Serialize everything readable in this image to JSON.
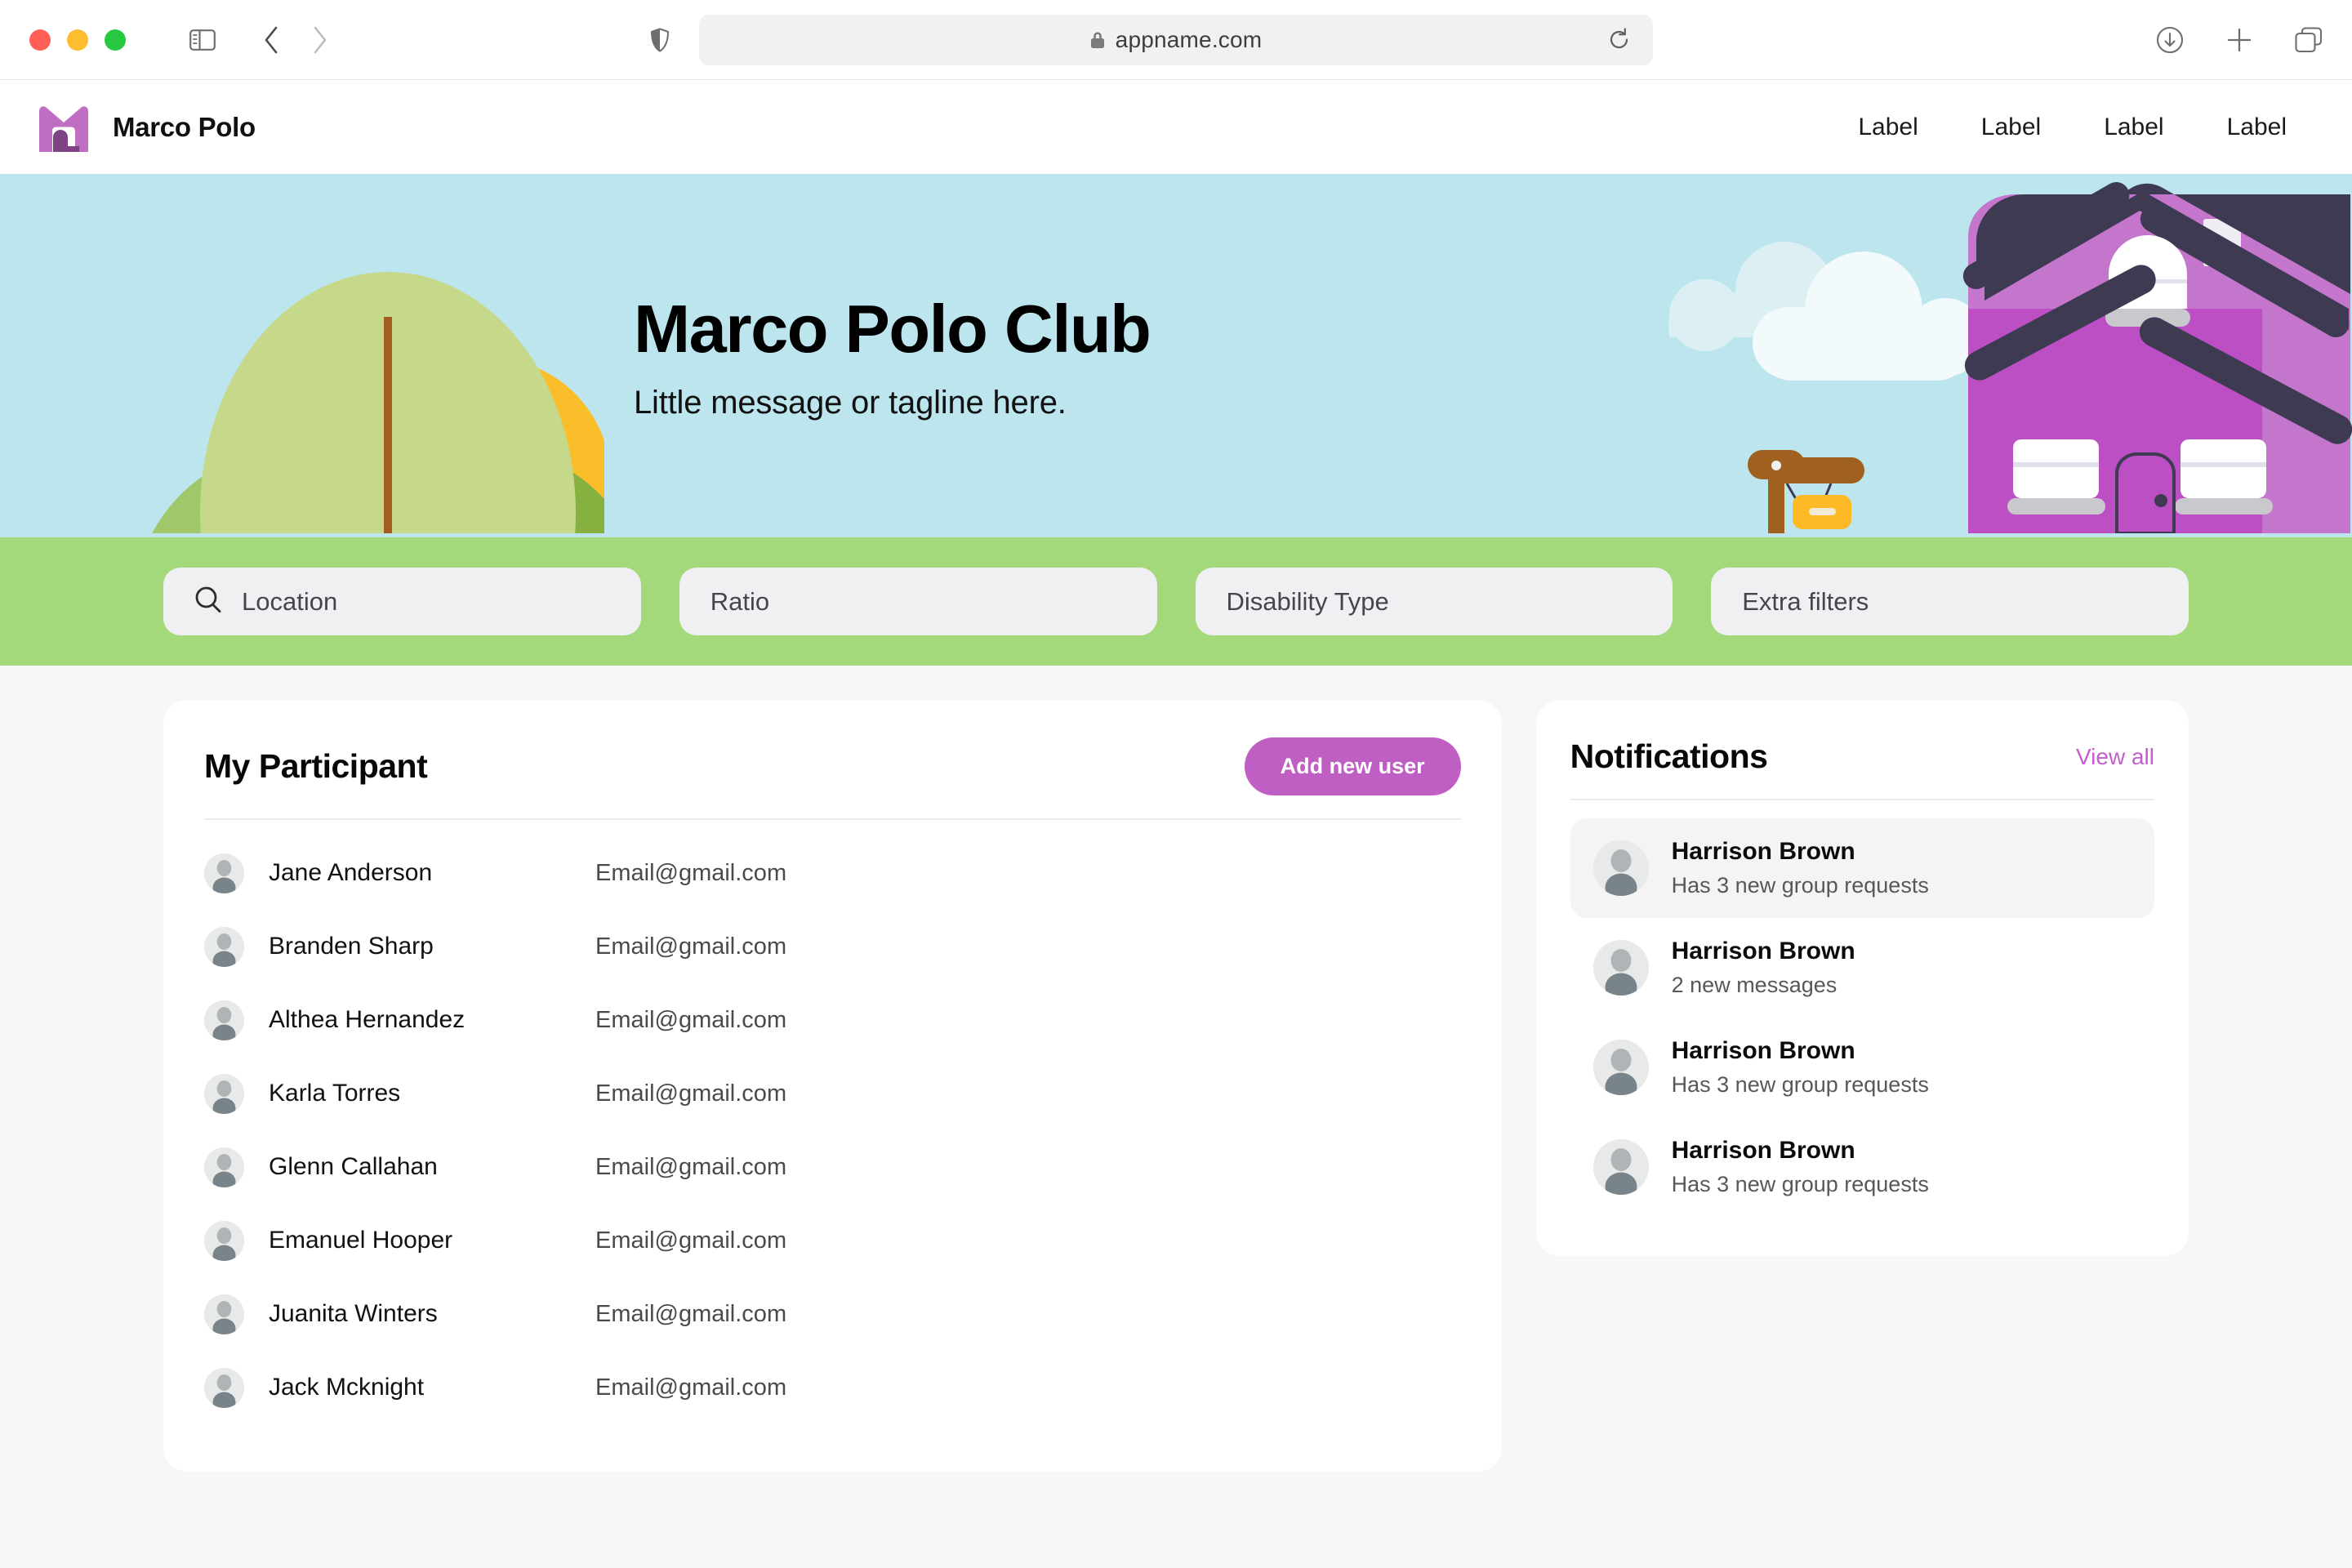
{
  "browser": {
    "url": "appname.com",
    "icons": {
      "sidebar": "sidebar-toggle-icon",
      "back": "back-chevron-icon",
      "forward": "forward-chevron-icon",
      "shield": "shield-privacy-icon",
      "lock": "lock-icon",
      "reload": "reload-icon",
      "downloads": "download-icon",
      "new_tab": "plus-icon",
      "tab_overview": "tab-overview-icon"
    },
    "traffic_lights": {
      "close": "#ff5f57",
      "minimize": "#febc2e",
      "maximize": "#28c840"
    }
  },
  "header": {
    "brand_name": "Marco Polo",
    "logo": "marco-polo-house-logo",
    "nav": [
      {
        "label": "Label"
      },
      {
        "label": "Label"
      },
      {
        "label": "Label"
      },
      {
        "label": "Label"
      }
    ]
  },
  "hero": {
    "title": "Marco Polo Club",
    "tagline": "Little message or tagline here.",
    "background_color": "#bce5ed",
    "art_left": "trees-and-sun-illustration",
    "art_right": "purple-house-illustration"
  },
  "filters": {
    "bar_color": "#a4d97b",
    "fields": [
      {
        "label": "Location",
        "icon": "search-icon"
      },
      {
        "label": "Ratio",
        "icon": null
      },
      {
        "label": "Disability Type",
        "icon": null
      },
      {
        "label": "Extra filters",
        "icon": null
      }
    ]
  },
  "participants": {
    "title": "My Participant",
    "add_button": "Add new user",
    "accent_color": "#bf5fc4",
    "rows": [
      {
        "name": "Jane Anderson",
        "email": "Email@gmail.com"
      },
      {
        "name": "Branden Sharp",
        "email": "Email@gmail.com"
      },
      {
        "name": "Althea Hernandez",
        "email": "Email@gmail.com"
      },
      {
        "name": "Karla Torres",
        "email": "Email@gmail.com"
      },
      {
        "name": "Glenn Callahan",
        "email": "Email@gmail.com"
      },
      {
        "name": "Emanuel Hooper",
        "email": "Email@gmail.com"
      },
      {
        "name": "Juanita Winters",
        "email": "Email@gmail.com"
      },
      {
        "name": "Jack Mcknight",
        "email": "Email@gmail.com"
      }
    ]
  },
  "notifications": {
    "title": "Notifications",
    "view_all": "View all",
    "link_color": "#c45ecb",
    "items": [
      {
        "name": "Harrison Brown",
        "message": "Has 3 new group requests",
        "highlighted": true
      },
      {
        "name": "Harrison Brown",
        "message": "2 new messages",
        "highlighted": false
      },
      {
        "name": "Harrison Brown",
        "message": "Has 3 new group requests",
        "highlighted": false
      },
      {
        "name": "Harrison Brown",
        "message": "Has 3 new group requests",
        "highlighted": false
      }
    ]
  }
}
